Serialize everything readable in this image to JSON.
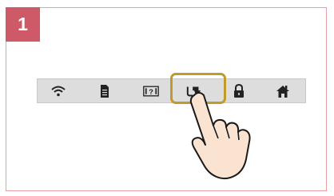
{
  "step": {
    "number": "1"
  },
  "toolbar": {
    "items": [
      {
        "icon": "wifi-icon",
        "label": ""
      },
      {
        "icon": "document-icon",
        "label": ""
      },
      {
        "icon": "help-icon",
        "label": ""
      },
      {
        "icon": "usb-connect-icon",
        "label": ""
      },
      {
        "icon": "lock-icon",
        "label": ""
      },
      {
        "icon": "home-icon",
        "label": ""
      }
    ],
    "selected": "usb-connect-icon"
  },
  "colors": {
    "badge": "#cf5a67",
    "panel_border": "#e8a0a6",
    "toolbar_bg": "#dddddd",
    "highlight": "#c09a2a",
    "icon": "#222222"
  }
}
